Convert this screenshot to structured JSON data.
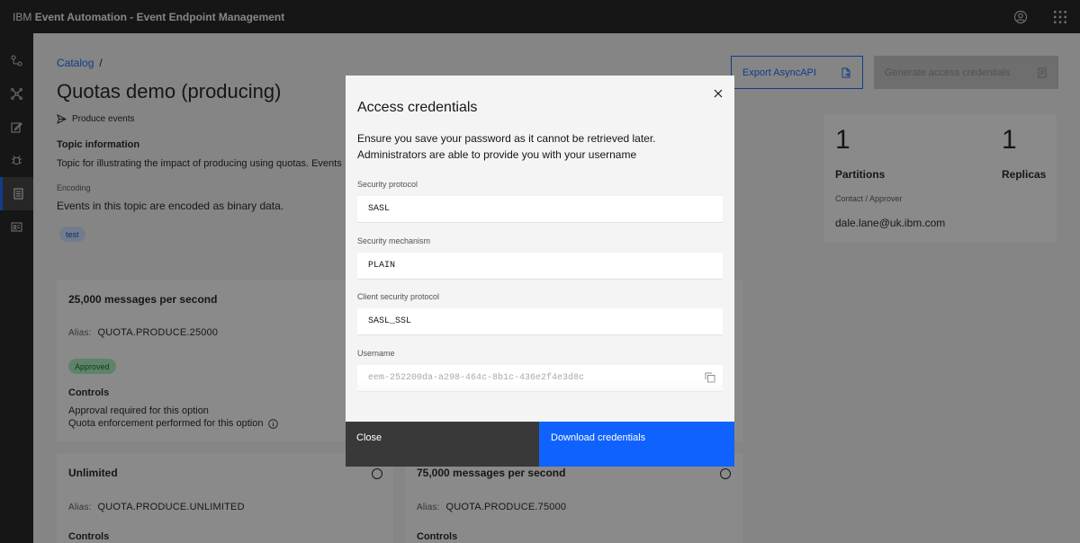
{
  "header": {
    "brand": "IBM",
    "product": "Event Automation - Event Endpoint Management",
    "icons": [
      "user-avatar-icon",
      "app-switcher-icon"
    ]
  },
  "sidebar": {
    "items": [
      "topology-icon",
      "event-processing-icon",
      "edit-icon",
      "debug-icon",
      "catalog-icon",
      "subscriptions-icon"
    ]
  },
  "page": {
    "breadcrumb_link": "Catalog",
    "breadcrumb_sep": "/",
    "title": "Quotas demo (producing)",
    "produce_label": "Produce events",
    "topic_heading": "Topic information",
    "topic_description": "Topic for illustrating the impact of producing using quotas. Events",
    "encoding_label": "Encoding",
    "encoding_value": "Events in this topic are encoded as binary data.",
    "tag": "test",
    "export_button": "Export AsyncAPI",
    "generate_button": "Generate access credentials"
  },
  "stats": {
    "partitions_value": "1",
    "partitions_label": "Partitions",
    "replicas_value": "1",
    "replicas_label": "Replicas",
    "contact_label": "Contact / Approver",
    "contact_value": "dale.lane@uk.ibm.com"
  },
  "options": [
    {
      "title": "25,000 messages per second",
      "alias_label": "Alias:",
      "alias": "QUOTA.PRODUCE.25000",
      "status": "Approved",
      "controls_label": "Controls",
      "controls": [
        "Approval required for this option",
        "Quota enforcement performed for this option"
      ]
    },
    {
      "title": "Unlimited",
      "alias_label": "Alias:",
      "alias": "QUOTA.PRODUCE.UNLIMITED",
      "controls_label": "Controls"
    },
    {
      "title": "75,000 messages per second",
      "alias_label": "Alias:",
      "alias": "QUOTA.PRODUCE.75000",
      "controls_label": "Controls"
    }
  ],
  "modal": {
    "title": "Access credentials",
    "description_line1": "Ensure you save your password as it cannot be retrieved later.",
    "description_line2": "Administrators are able to provide you with your username",
    "fields": [
      {
        "label": "Security protocol",
        "value": "SASL"
      },
      {
        "label": "Security mechanism",
        "value": "PLAIN"
      },
      {
        "label": "Client security protocol",
        "value": "SASL_SSL"
      },
      {
        "label": "Username",
        "value": "eem-252200da-a298-464c-8b1c-436e2f4e3d8c"
      }
    ],
    "close_button": "Close",
    "download_button": "Download credentials"
  }
}
